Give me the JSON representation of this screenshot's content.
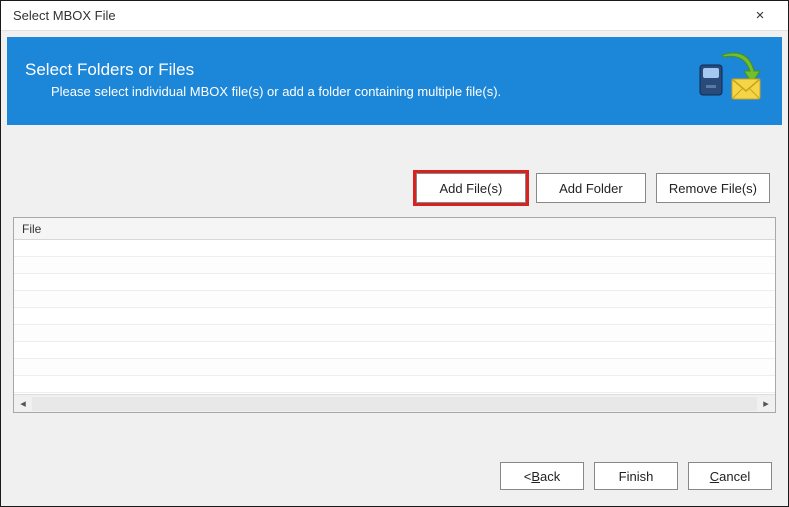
{
  "window": {
    "title": "Select MBOX File",
    "close_label": "×"
  },
  "banner": {
    "title": "Select Folders or Files",
    "subtitle": "Please select individual MBOX file(s) or add a folder containing multiple file(s)."
  },
  "buttons": {
    "add_files": "Add File(s)",
    "add_folder": "Add Folder",
    "remove_files": "Remove File(s)"
  },
  "file_list": {
    "header": "File"
  },
  "nav": {
    "back_prefix": "<",
    "back_letter": "B",
    "back_rest": "ack",
    "finish": "Finish",
    "cancel_letter": "C",
    "cancel_rest": "ancel"
  },
  "colors": {
    "banner_bg": "#1c86d8",
    "highlight_border": "#d8221f"
  }
}
